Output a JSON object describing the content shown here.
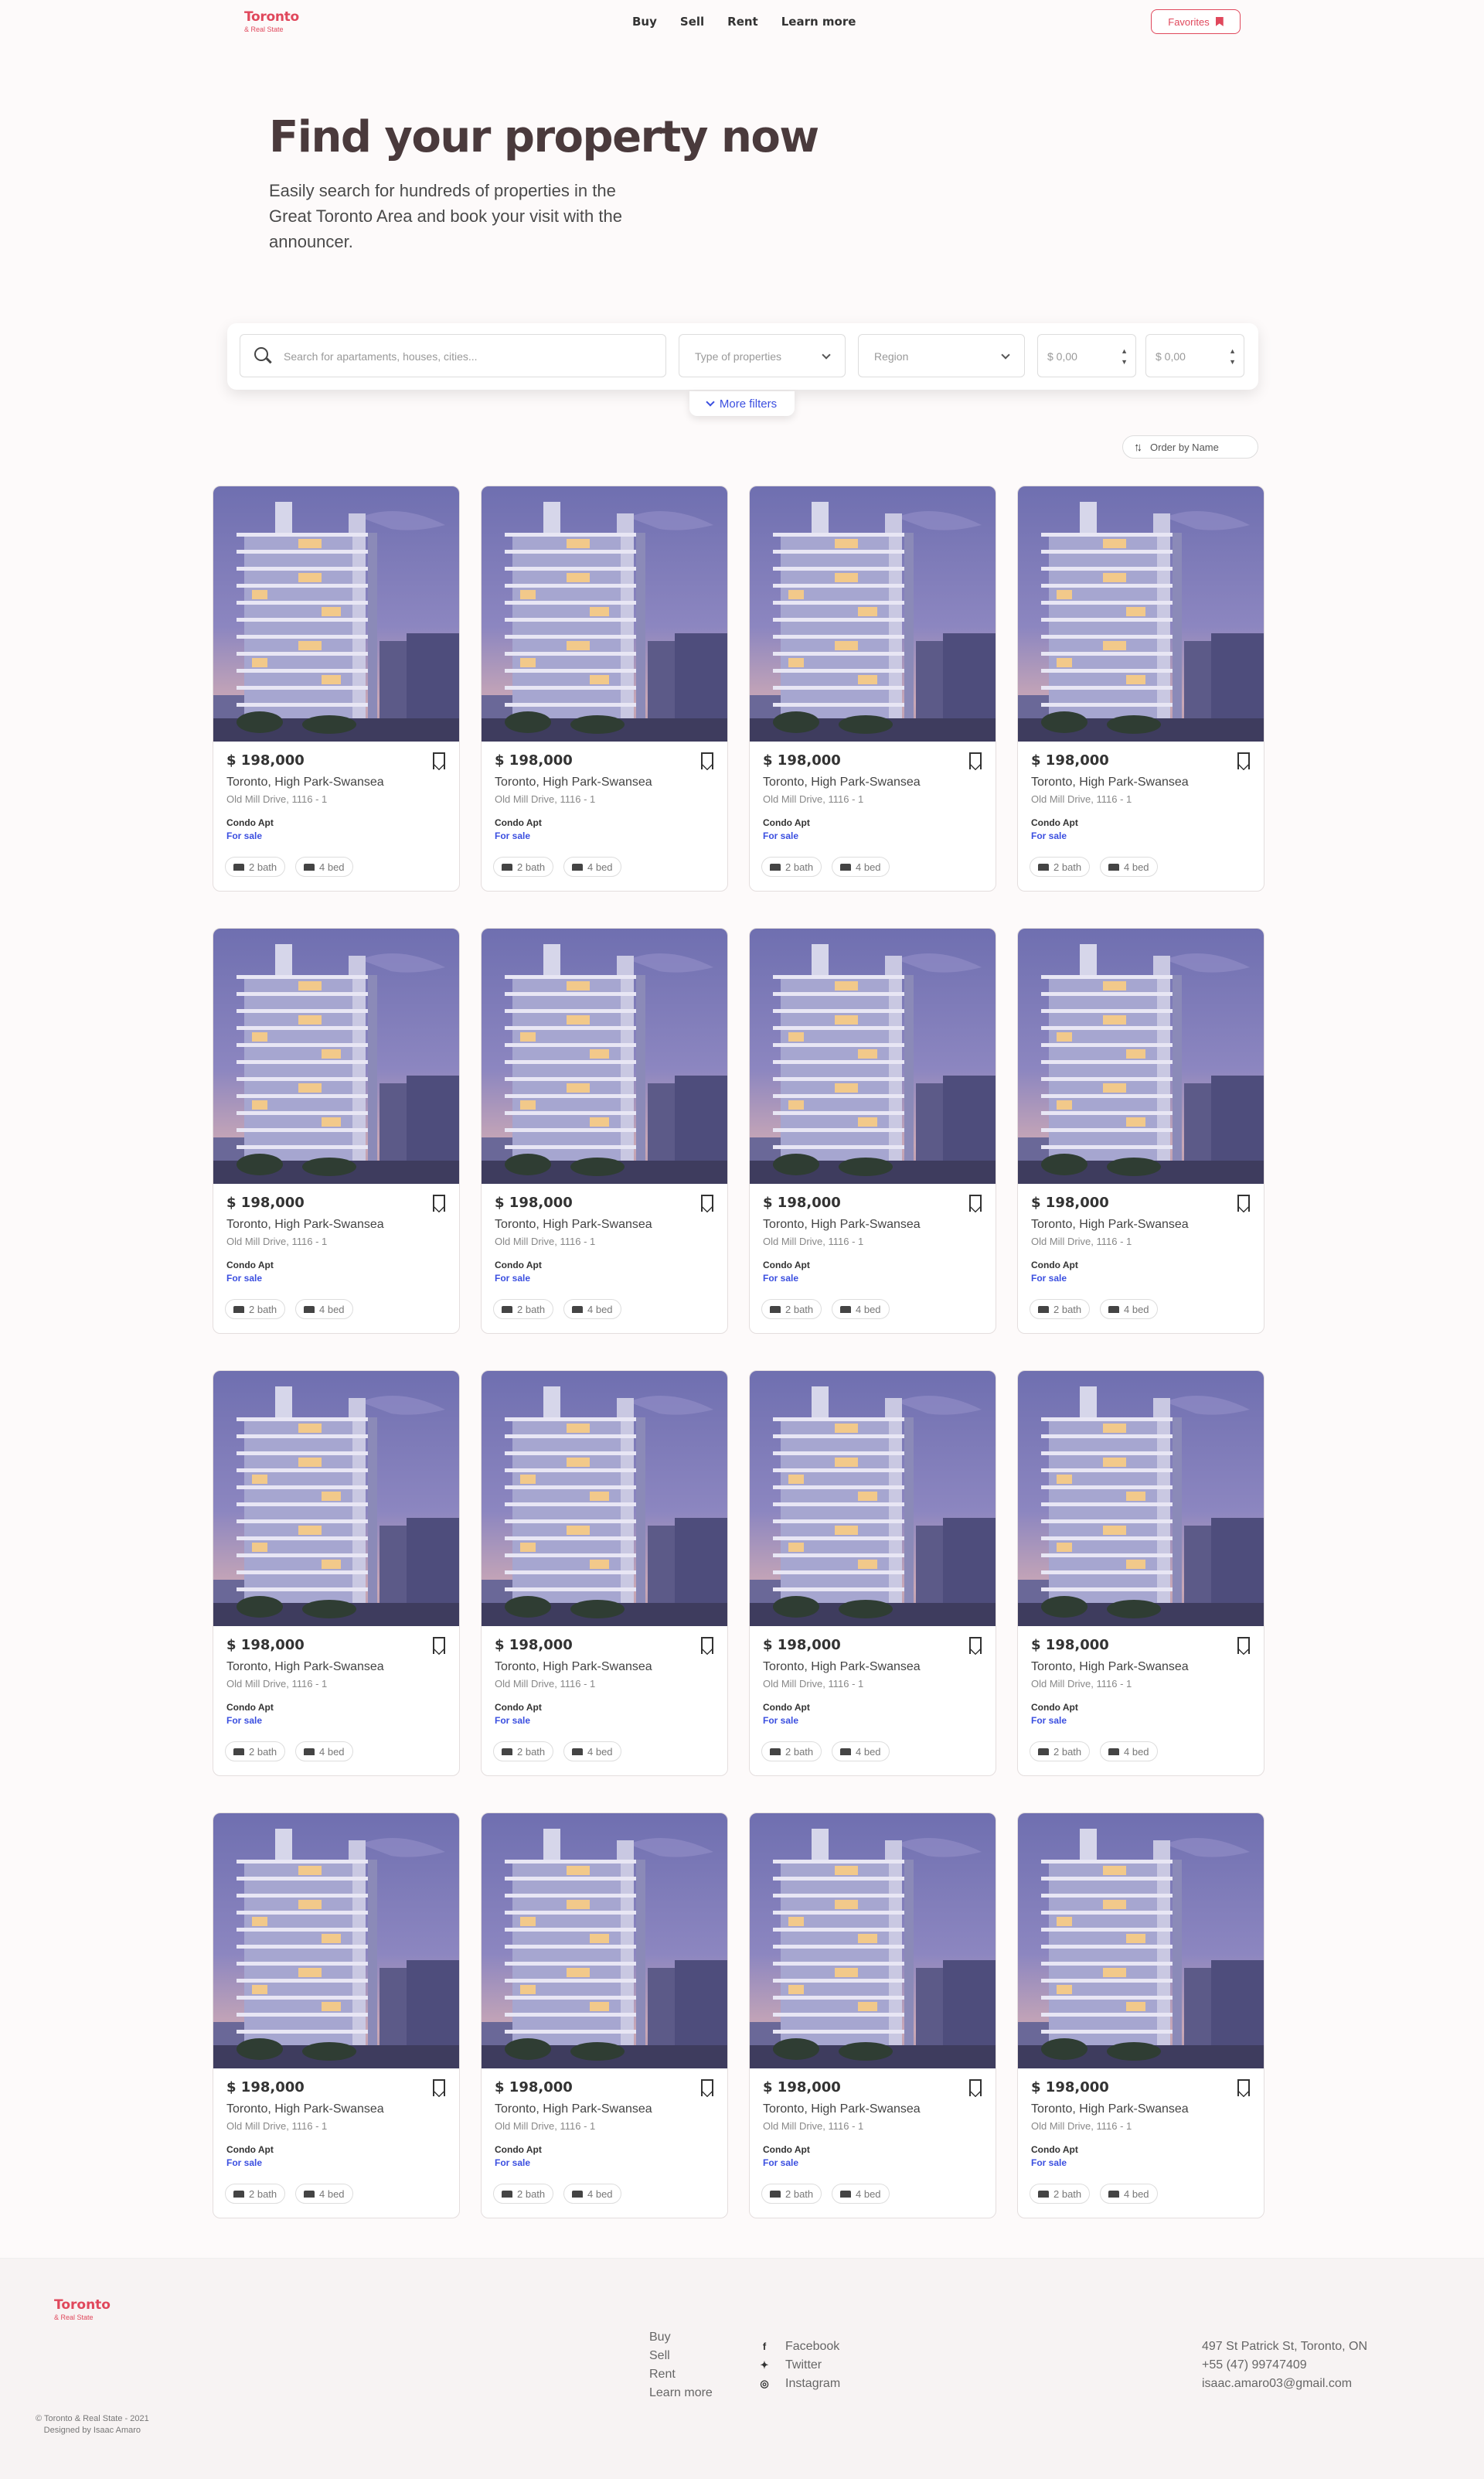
{
  "header": {
    "logo_name": "Toronto",
    "logo_sub": "& Real State",
    "nav": [
      "Buy",
      "Sell",
      "Rent",
      "Learn more"
    ],
    "favorites_label": "Favorites"
  },
  "hero": {
    "title": "Find your property now",
    "subtitle": "Easily search for hundreds of properties in the Great Toronto Area and book your visit with the announcer."
  },
  "search": {
    "placeholder": "Search for apartaments, houses, cities...",
    "type_placeholder": "Type of properties",
    "region_placeholder": "Region",
    "min_price_placeholder": "$ 0,00",
    "max_price_placeholder": "$ 0,00",
    "more_filters_label": "More filters"
  },
  "order_label": "Order by Name",
  "listing": {
    "price": "$ 198,000",
    "location": "Toronto, High Park-Swansea",
    "address": "Old Mill Drive, 1116 - 1",
    "type": "Condo Apt",
    "status": "For sale",
    "bath": "2 bath",
    "bed": "4 bed",
    "count": 16
  },
  "footer": {
    "logo_name": "Toronto",
    "logo_sub": "& Real State",
    "copyright": "© Toronto & Real State - 2021",
    "designed_by": "Designed by Isaac Amaro",
    "links": [
      "Buy",
      "Sell",
      "Rent",
      "Learn more"
    ],
    "social": [
      {
        "icon": "facebook-icon",
        "label": "Facebook"
      },
      {
        "icon": "twitter-icon",
        "label": "Twitter"
      },
      {
        "icon": "instagram-icon",
        "label": "Instagram"
      }
    ],
    "address": "497 St Patrick St, Toronto, ON",
    "phone": "+55 (47) 99747409",
    "email": "isaac.amaro03@gmail.com"
  },
  "colors": {
    "accent": "#e0485c",
    "link_blue": "#3b4fe0"
  }
}
